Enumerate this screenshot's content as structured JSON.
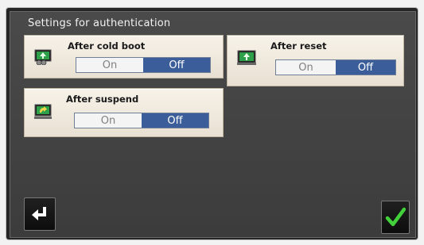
{
  "screen": {
    "title": "Settings for authentication"
  },
  "settings": [
    {
      "label": "After cold boot",
      "icon": "cold-boot-icon",
      "on_label": "On",
      "off_label": "Off",
      "selected": "Off"
    },
    {
      "label": "After reset",
      "icon": "reset-icon",
      "on_label": "On",
      "off_label": "Off",
      "selected": "Off"
    },
    {
      "label": "After suspend",
      "icon": "suspend-icon",
      "on_label": "On",
      "off_label": "Off",
      "selected": "Off"
    }
  ],
  "buttons": {
    "back_icon": "return-arrow-icon",
    "confirm_icon": "checkmark-icon"
  },
  "colors": {
    "background": "#3c3c3c",
    "selected_toggle": "#3b5e9a",
    "panel": "#f0eadf",
    "confirm_check": "#42d13a"
  }
}
